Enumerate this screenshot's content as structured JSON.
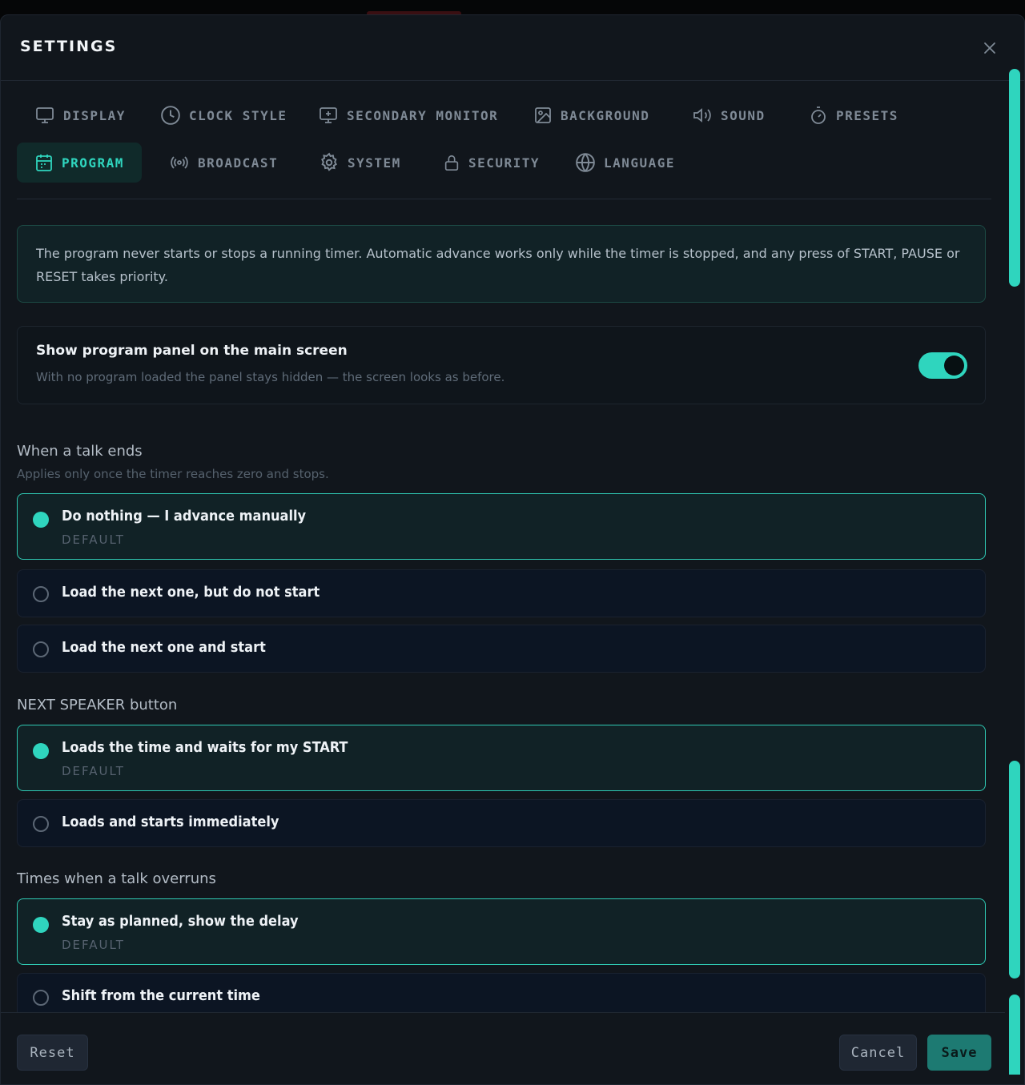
{
  "modal": {
    "title": "SETTINGS",
    "close_icon": "close-icon"
  },
  "tabs": [
    {
      "label": "DISPLAY",
      "icon": "monitor-icon",
      "active": false
    },
    {
      "label": "CLOCK STYLE",
      "icon": "clock-icon",
      "active": false
    },
    {
      "label": "SECONDARY MONITOR",
      "icon": "monitor-plus-icon",
      "active": false
    },
    {
      "label": "BACKGROUND",
      "icon": "image-icon",
      "active": false
    },
    {
      "label": "SOUND",
      "icon": "speaker-icon",
      "active": false
    },
    {
      "label": "PRESETS",
      "icon": "timer-icon",
      "active": false
    },
    {
      "label": "PROGRAM",
      "icon": "calendar-icon",
      "active": true
    },
    {
      "label": "BROADCAST",
      "icon": "broadcast-icon",
      "active": false
    },
    {
      "label": "SYSTEM",
      "icon": "gear-icon",
      "active": false
    },
    {
      "label": "SECURITY",
      "icon": "lock-icon",
      "active": false
    },
    {
      "label": "LANGUAGE",
      "icon": "globe-icon",
      "active": false
    }
  ],
  "info": {
    "text": "The program never starts or stops a running timer. Automatic advance works only while the timer is stopped, and any press of START, PAUSE or RESET takes priority."
  },
  "show_panel": {
    "title": "Show program panel on the main screen",
    "subtitle": "With no program loaded the panel stays hidden — the screen looks as before.",
    "enabled": true
  },
  "talk_ends": {
    "label": "When a talk ends",
    "subtitle": "Applies only once the timer reaches zero and stops.",
    "options": [
      {
        "label": "Do nothing — I advance manually",
        "tag": "DEFAULT",
        "selected": true
      },
      {
        "label": "Load the next one, but do not start",
        "tag": "",
        "selected": false
      },
      {
        "label": "Load the next one and start",
        "tag": "",
        "selected": false
      }
    ]
  },
  "next_speaker": {
    "label": "NEXT SPEAKER button",
    "options": [
      {
        "label": "Loads the time and waits for my START",
        "tag": "DEFAULT",
        "selected": true
      },
      {
        "label": "Loads and starts immediately",
        "tag": "",
        "selected": false
      }
    ]
  },
  "overrun": {
    "label": "Times when a talk overruns",
    "options": [
      {
        "label": "Stay as planned, show the delay",
        "tag": "DEFAULT",
        "selected": true
      },
      {
        "label": "Shift from the current time",
        "tag": "",
        "selected": false
      }
    ]
  },
  "footer": {
    "reset_label": "Reset",
    "cancel_label": "Cancel",
    "save_label": "Save"
  },
  "colors": {
    "accent": "#2fd5be",
    "background": "#11161c",
    "option_bg": "#0c1523"
  }
}
